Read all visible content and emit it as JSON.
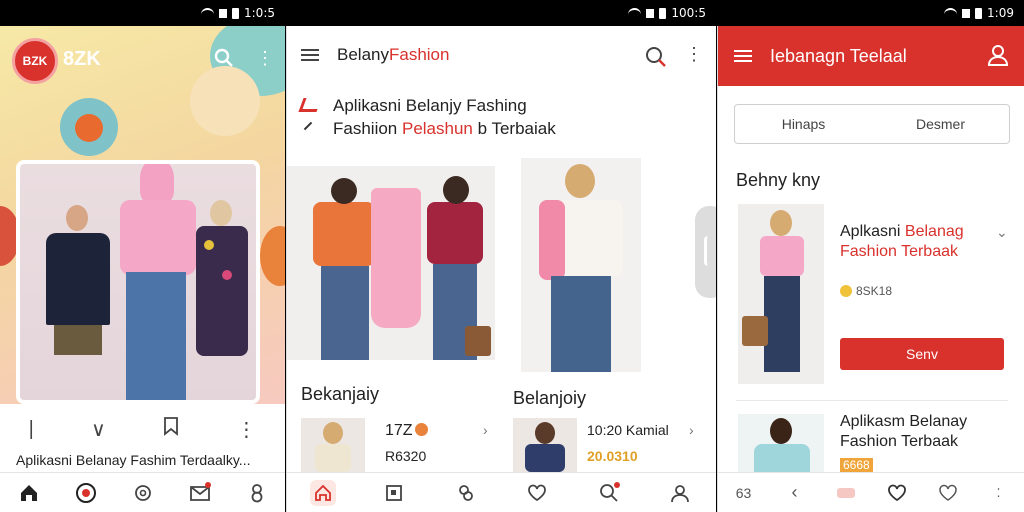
{
  "status_bars": [
    {
      "time": "1:0:5"
    },
    {
      "time": "100:5"
    },
    {
      "time": "1:09"
    }
  ],
  "screen1": {
    "logo_text": "BZK",
    "brand": "8ZK",
    "caption": "Aplikasni Belanay Fashim Terdaalky...",
    "nav": [
      "home-icon",
      "brand-icon",
      "refresh-icon",
      "mail-icon",
      "profile-icon"
    ]
  },
  "screen2": {
    "title_part1": "Belany",
    "title_part2": "Fashion",
    "heading1": "Aplikasni Belanjy Fashing",
    "heading2_part1": "Fashiion ",
    "heading2_part2": "Pelashun",
    "heading2_part3": " b Terbaiak",
    "section1": "Bekanjaiy",
    "section2": "Belanjoiy",
    "item1": {
      "title": "17Z",
      "price": "R6320"
    },
    "item2": {
      "title": "10:20 Kamial",
      "price": "20.0310"
    }
  },
  "screen3": {
    "title": "Iebanagn Teelaal",
    "tabs": [
      "Hinaps",
      "Desmer"
    ],
    "section": "Behny kny",
    "item1": {
      "name_part1": "Aplkasni ",
      "name_part2": "Belanag",
      "name_part3": "Fashion Terbaak",
      "price": "8SK18",
      "button": "Senv"
    },
    "item2": {
      "name_line1": "Aplikasm Belanay",
      "name_line2": "Fashion Terbaak",
      "badge": "6668"
    },
    "nav_label": "63"
  },
  "colors": {
    "accent": "#d9312c"
  }
}
